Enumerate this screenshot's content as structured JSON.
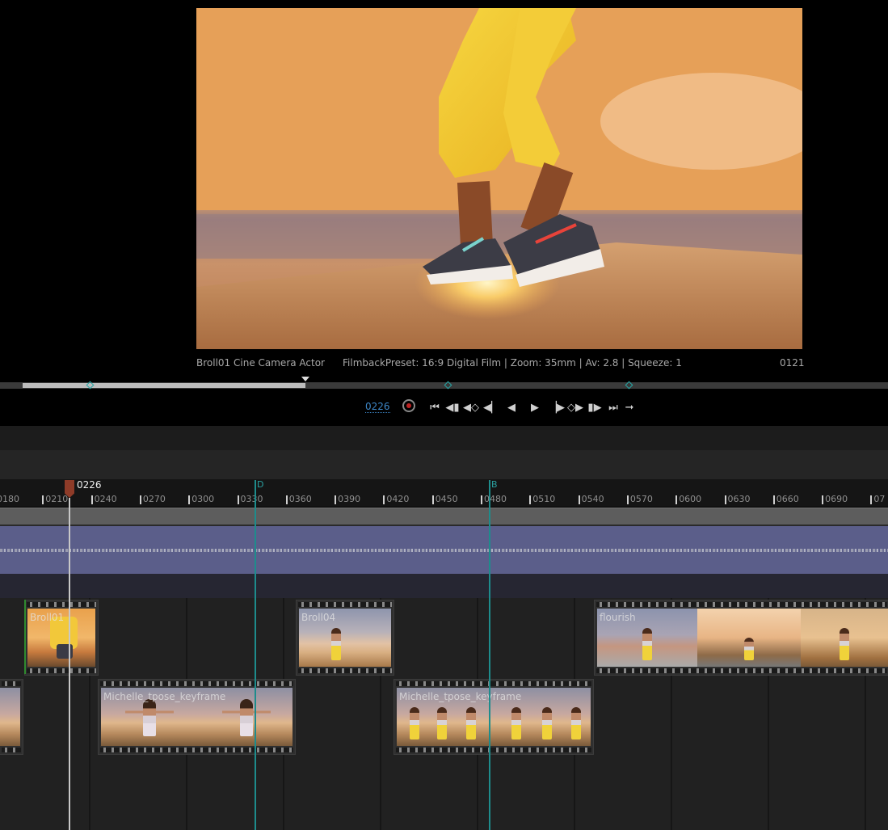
{
  "viewport": {
    "camera_name": "Broll01  Cine Camera Actor",
    "camera_info": "FilmbackPreset: 16:9 Digital Film | Zoom: 35mm | Av: 2.8 | Squeeze: 1",
    "frame": "0121"
  },
  "transport": {
    "current_frame": "0226",
    "scrub_progress": 0.345,
    "icons": [
      "record-icon",
      "jump-to-start-icon",
      "step-back-key-icon",
      "prev-key-icon",
      "step-back-frame-icon",
      "play-reverse-icon",
      "play-icon",
      "step-forward-frame-icon",
      "next-key-icon",
      "step-forward-key-icon",
      "jump-to-end-icon",
      "loop-icon"
    ]
  },
  "timeline": {
    "playhead_label": "0226",
    "ticks": [
      "0180",
      "0210",
      "0240",
      "0270",
      "0300",
      "0330",
      "0360",
      "0390",
      "0420",
      "0450",
      "0480",
      "0510",
      "0540",
      "0570",
      "0600",
      "0630",
      "0660",
      "0690",
      "07"
    ],
    "markers": [
      "D",
      "B"
    ]
  },
  "shots": [
    {
      "label": "Broll01"
    },
    {
      "label": "Broll04"
    },
    {
      "label": "flourish"
    },
    {
      "label": "Michelle_tpose_keyframe"
    },
    {
      "label": "Michelle_tpose_keyframe"
    }
  ],
  "colors": {
    "accent": "#1e8c8c",
    "playhead": "#8e3b28",
    "audio": "#5b5e8a"
  }
}
